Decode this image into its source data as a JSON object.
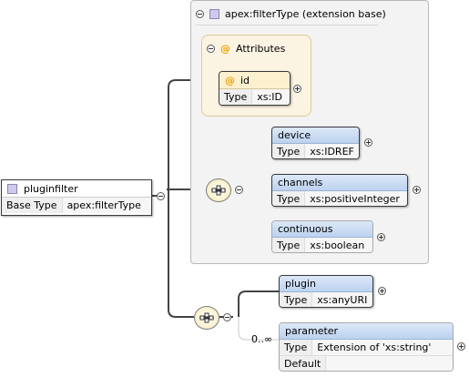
{
  "extension": {
    "title": "apex:filterType (extension base)"
  },
  "attributes": {
    "label": "Attributes",
    "items": [
      {
        "name": "id",
        "type_label": "Type",
        "type": "xs:ID"
      }
    ]
  },
  "root": {
    "name": "pluginfilter",
    "base_label": "Base Type",
    "base_type": "apex:filterType"
  },
  "sequence1": [
    {
      "name": "device",
      "type_label": "Type",
      "type": "xs:IDREF"
    },
    {
      "name": "channels",
      "type_label": "Type",
      "type": "xs:positiveInteger"
    },
    {
      "name": "continuous",
      "type_label": "Type",
      "type": "xs:boolean"
    }
  ],
  "sequence2": [
    {
      "name": "plugin",
      "type_label": "Type",
      "type": "xs:anyURI"
    },
    {
      "name": "parameter",
      "type_label": "Type",
      "type": "Extension of 'xs:string'",
      "default_label": "Default",
      "default": "",
      "cardinality": "0..∞"
    }
  ],
  "colors": {
    "element_header": "#bcd2ef",
    "attribute_group": "#fcf4e2",
    "sequence": "#f3e6b0"
  }
}
